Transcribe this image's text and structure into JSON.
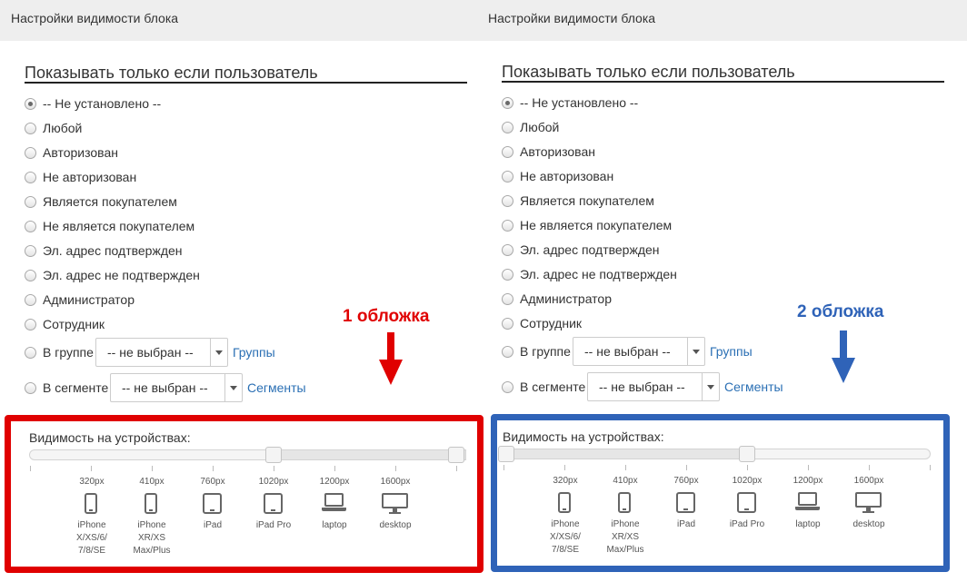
{
  "panels": [
    {
      "header_title": "Настройки видимости блока",
      "section_title": "Показывать только если пользователь",
      "options": [
        "-- Не установлено --",
        "Любой",
        "Авторизован",
        "Не авторизован",
        "Является покупателем",
        "Не является покупателем",
        "Эл. адрес подтвержден",
        "Эл. адрес не подтвержден",
        "Администратор",
        "Сотрудник"
      ],
      "selected_option": "-- Не установлено --",
      "group_label": "В группе",
      "group_select": "-- не выбран --",
      "group_link": "Группы",
      "segment_label": "В сегменте",
      "segment_select": "-- не выбран --",
      "segment_link": "Сегменты",
      "cover_label": "1 обложка",
      "cover_color": "#e00000",
      "visibility_title": "Видимость на устройствах:",
      "slider_range": [
        0.5,
        1.0
      ],
      "devices": [
        {
          "px": "320px",
          "name": "iPhone X/XS/6/ 7/8/SE",
          "icon": "phone-icon"
        },
        {
          "px": "410px",
          "name": "iPhone XR/XS Max/Plus",
          "icon": "phone-icon"
        },
        {
          "px": "760px",
          "name": "iPad",
          "icon": "tablet-icon"
        },
        {
          "px": "1020px",
          "name": "iPad Pro",
          "icon": "tablet-icon"
        },
        {
          "px": "1200px",
          "name": "laptop",
          "icon": "laptop-icon"
        },
        {
          "px": "1600px",
          "name": "desktop",
          "icon": "desktop-icon"
        }
      ]
    },
    {
      "header_title": "Настройки видимости блока",
      "section_title": "Показывать только если пользователь",
      "options": [
        "-- Не установлено --",
        "Любой",
        "Авторизован",
        "Не авторизован",
        "Является покупателем",
        "Не является покупателем",
        "Эл. адрес подтвержден",
        "Эл. адрес не подтвержден",
        "Администратор",
        "Сотрудник"
      ],
      "selected_option": "-- Не установлено --",
      "group_label": "В группе",
      "group_select": "-- не выбран --",
      "group_link": "Группы",
      "segment_label": "В сегменте",
      "segment_select": "-- не выбран --",
      "segment_link": "Сегменты",
      "cover_label": "2 обложка",
      "cover_color": "#2f63b8",
      "visibility_title": "Видимость на устройствах:",
      "slider_range": [
        0.0,
        0.5
      ],
      "devices": [
        {
          "px": "320px",
          "name": "iPhone X/XS/6/ 7/8/SE",
          "icon": "phone-icon"
        },
        {
          "px": "410px",
          "name": "iPhone XR/XS Max/Plus",
          "icon": "phone-icon"
        },
        {
          "px": "760px",
          "name": "iPad",
          "icon": "tablet-icon"
        },
        {
          "px": "1020px",
          "name": "iPad Pro",
          "icon": "tablet-icon"
        },
        {
          "px": "1200px",
          "name": "laptop",
          "icon": "laptop-icon"
        },
        {
          "px": "1600px",
          "name": "desktop",
          "icon": "desktop-icon"
        }
      ]
    }
  ]
}
